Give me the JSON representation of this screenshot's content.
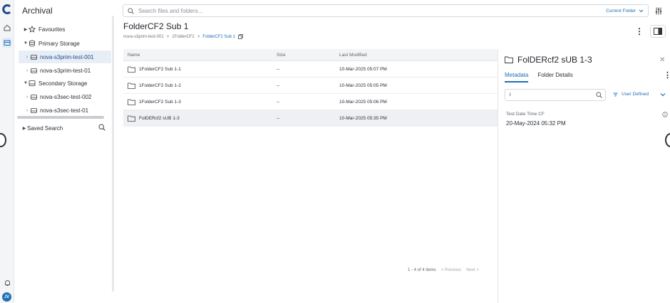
{
  "sidebar": {
    "title": "Archival",
    "tree": [
      {
        "label": "Favourites",
        "icon": "star-icon"
      },
      {
        "label": "Primary Storage",
        "icon": "database-icon"
      },
      {
        "label": "nova-s3prim-test-001",
        "icon": "drive-icon"
      },
      {
        "label": "nova-s3prim-test-01",
        "icon": "drive-icon"
      },
      {
        "label": "Secondary Storage",
        "icon": "drive-tray-icon"
      },
      {
        "label": "nova-s3sec-test-002",
        "icon": "drive-icon"
      },
      {
        "label": "nova-s3sec-test-01",
        "icon": "drive-icon"
      },
      {
        "label": "Saved Search",
        "icon": "search-icon"
      }
    ]
  },
  "rail": {
    "avatar": "JV"
  },
  "search": {
    "placeholder": "Search files and folders...",
    "scope": "Current Folder"
  },
  "header": {
    "title": "FolderCF2 Sub 1",
    "breadcrumb": [
      "nova-s3prim-test-001",
      "1FolderCF2",
      "FolderCF2 Sub 1"
    ],
    "separator": ">"
  },
  "table": {
    "columns": [
      "Name",
      "Size",
      "Last Modified"
    ],
    "rows": [
      {
        "name": "1FolderCF2 Sub 1-1",
        "size": "--",
        "modified": "10-Mar-2025 05:07 PM"
      },
      {
        "name": "1FolderCF2 Sub 1-2",
        "size": "--",
        "modified": "10-Mar-2025 05:05 PM"
      },
      {
        "name": "1FolderCF2 Sub 1-3",
        "size": "--",
        "modified": "10-Mar-2025 05:06 PM"
      },
      {
        "name": "FolDERcf2 sUB 1-3",
        "size": "--",
        "modified": "10-Mar-2025 05:35 PM"
      }
    ]
  },
  "pager": {
    "summary": "1 - 4 of 4 items",
    "previous": "< Previous",
    "next": "Next >"
  },
  "details": {
    "title": "FolDERcf2 sUB 1-3",
    "tabs": [
      "Metadata",
      "Folder Details"
    ],
    "filter_value": "i",
    "filter_mode": "User Defined",
    "metadata": {
      "label": "Test Date Time CF",
      "value": "20-May-2024 05:32 PM"
    }
  },
  "colors": {
    "accent": "#1f6fb5",
    "selected_row": "#eef0f3",
    "sidebar_selected": "#e8eef6"
  }
}
